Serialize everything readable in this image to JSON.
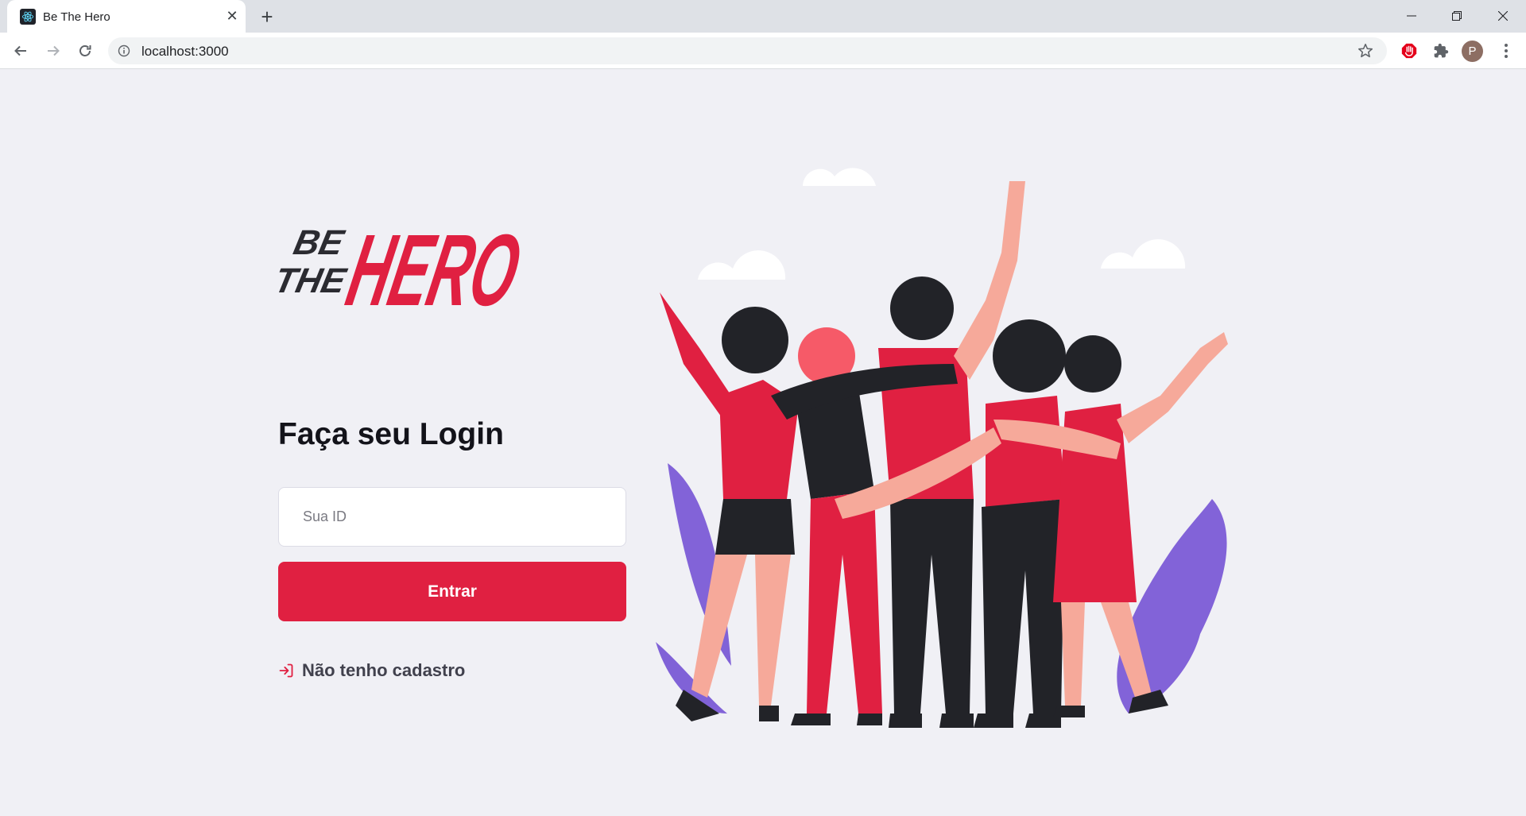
{
  "browser": {
    "tab_title": "Be The Hero",
    "tab_close": "✕",
    "new_tab": "+",
    "url": "localhost:3000",
    "profile_initial": "P"
  },
  "logo": {
    "line1": "BE",
    "line2": "THE",
    "line3": "HERO"
  },
  "login": {
    "title": "Faça seu Login",
    "id_placeholder": "Sua ID",
    "submit_label": "Entrar",
    "register_link": "Não tenho cadastro"
  },
  "colors": {
    "brand": "#e02041",
    "background": "#f0f0f5",
    "text_dark": "#13131a",
    "text": "#41414d"
  },
  "icons": {
    "favicon": "react-icon",
    "back": "arrow-left-icon",
    "forward": "arrow-right-icon",
    "reload": "reload-icon",
    "info": "info-icon",
    "bookmark": "star-icon",
    "extension_adblock": "adblock-icon",
    "extensions": "puzzle-icon",
    "menu": "kebab-menu-icon",
    "register": "log-in-icon"
  }
}
